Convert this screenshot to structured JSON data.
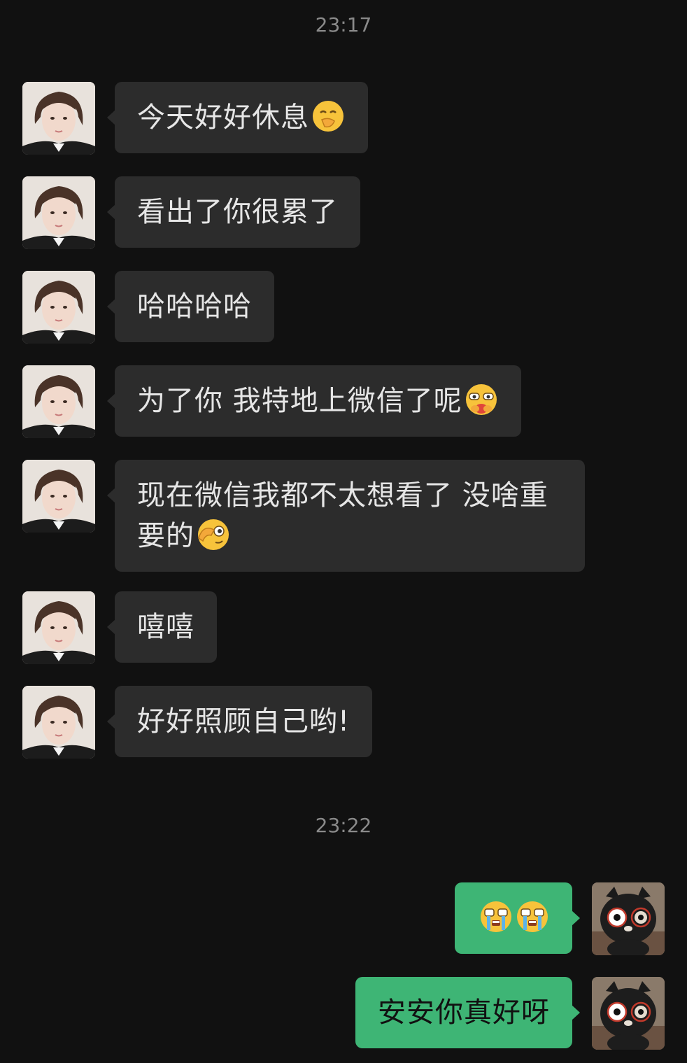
{
  "timestamps": [
    "23:17",
    "23:22"
  ],
  "messages_in": [
    {
      "text": "今天好好休息",
      "emoji": "hand-over-mouth-emoji"
    },
    {
      "text": "看出了你很累了",
      "emoji": ""
    },
    {
      "text": "哈哈哈哈",
      "emoji": ""
    },
    {
      "text": "为了你 我特地上微信了呢",
      "emoji": "blushing-hug-emoji"
    },
    {
      "text": "现在微信我都不太想看了 没啥重要的",
      "emoji": "facepalm-peek-emoji"
    },
    {
      "text": "嘻嘻",
      "emoji": ""
    },
    {
      "text": "好好照顾自己哟!",
      "emoji": ""
    }
  ],
  "messages_out": [
    {
      "text": "",
      "emoji": "crying-emoji crying-emoji"
    },
    {
      "text": "安安你真好呀",
      "emoji": ""
    }
  ],
  "colors": {
    "background": "#111111",
    "incoming_bubble": "#2c2c2c",
    "outgoing_bubble": "#3eb575",
    "timestamp": "#8a8a8a"
  }
}
